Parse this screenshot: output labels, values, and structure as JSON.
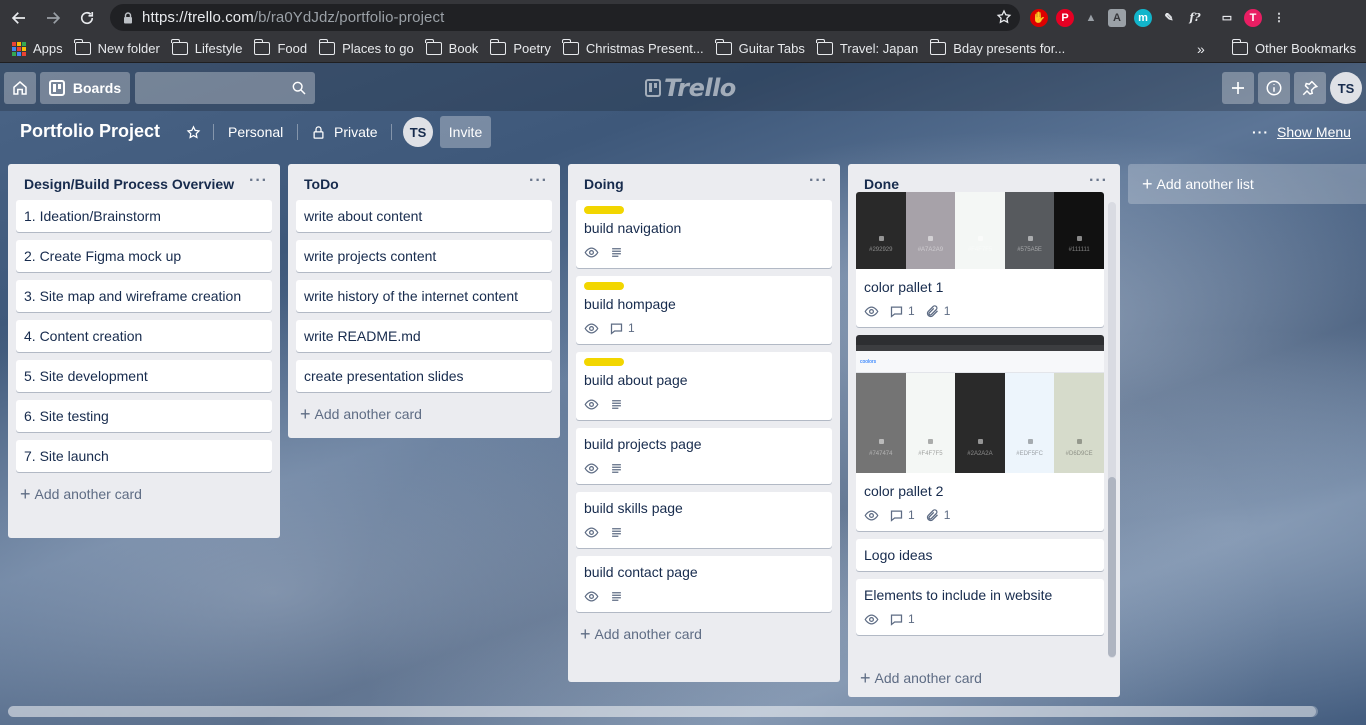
{
  "browser": {
    "url_host": "https://trello.com",
    "url_path": "/b/ra0YdJdz/portfolio-project",
    "bookmarks": [
      "Apps",
      "New folder",
      "Lifestyle",
      "Food",
      "Places to go",
      "Book",
      "Poetry",
      "Christmas Present...",
      "Guitar Tabs",
      "Travel: Japan",
      "Bday presents for..."
    ],
    "more": "»",
    "other_bookmarks": "Other Bookmarks",
    "profile_initial": "T"
  },
  "header": {
    "boards_label": "Boards",
    "logo_text": "Trello",
    "avatar": "TS"
  },
  "board": {
    "title": "Portfolio Project",
    "team": "Personal",
    "visibility": "Private",
    "member": "TS",
    "invite": "Invite",
    "show_menu": "Show Menu"
  },
  "lists": {
    "design": {
      "title": "Design/Build Process Overview",
      "cards": [
        "1. Ideation/Brainstorm",
        "2. Create Figma mock up",
        "3. Site map and wireframe creation",
        "4. Content creation",
        "5. Site development",
        "6. Site testing",
        "7. Site launch"
      ],
      "add": "Add another card"
    },
    "todo": {
      "title": "ToDo",
      "cards": [
        "write about content",
        "write projects content",
        "write history of the internet content",
        "write README.md",
        "create presentation slides"
      ],
      "add": "Add another card"
    },
    "doing": {
      "title": "Doing",
      "cards": [
        "build navigation",
        "build hompage",
        "build about page",
        "build projects page",
        "build skills page",
        "build contact page"
      ],
      "hompage_comments": "1",
      "add": "Add another card"
    },
    "done": {
      "title": "Done",
      "pallet1": {
        "title": "color pallet 1",
        "comments": "1",
        "attachments": "1",
        "swatches": [
          {
            "color": "#292929",
            "code": "#292929"
          },
          {
            "color": "#a7a2a9",
            "code": "#A7A2A9"
          },
          {
            "color": "#f4f7f5",
            "code": "#F4F7F5"
          },
          {
            "color": "#575a5e",
            "code": "#575A5E"
          },
          {
            "color": "#111111",
            "code": "#111111"
          }
        ]
      },
      "pallet2": {
        "title": "color pallet 2",
        "comments": "1",
        "attachments": "1",
        "site_label": "coolors",
        "swatches": [
          {
            "color": "#747474",
            "code": "#747474"
          },
          {
            "color": "#f4f7f5",
            "code": "#F4F7F5"
          },
          {
            "color": "#2a2a2a",
            "code": "#2A2A2A"
          },
          {
            "color": "#edf5fc",
            "code": "#EDF5FC"
          },
          {
            "color": "#d6dbcb",
            "code": "#D6D9CE"
          }
        ]
      },
      "logo": "Logo ideas",
      "elements": {
        "title": "Elements to include in website",
        "comments": "1"
      },
      "add": "Add another card"
    }
  },
  "add_list": "Add another list",
  "colors": {
    "label_yellow": "#f2d600",
    "list_bg": "#ebecf0"
  }
}
